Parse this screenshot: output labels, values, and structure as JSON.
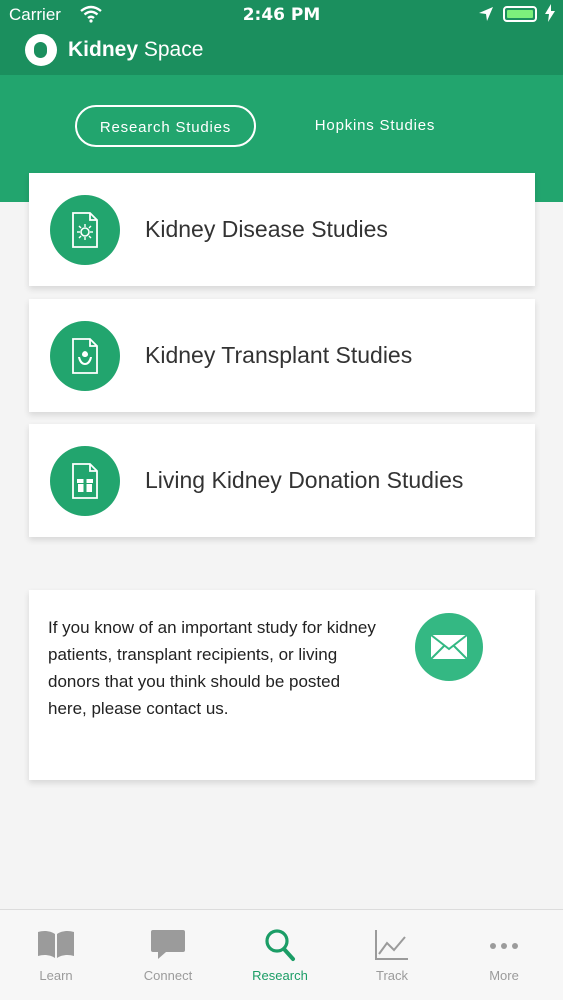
{
  "status_bar": {
    "carrier": "Carrier",
    "time": "2:46 PM"
  },
  "header": {
    "brand_bold": "Kidney",
    "brand_light": "Space"
  },
  "tabs": [
    {
      "label": "Research Studies",
      "active": true
    },
    {
      "label": "Hopkins Studies",
      "active": false
    }
  ],
  "studies": [
    {
      "label": "Kidney Disease Studies",
      "icon": "document-virus-icon"
    },
    {
      "label": "Kidney Transplant Studies",
      "icon": "document-hands-icon"
    },
    {
      "label": "Living Kidney Donation Studies",
      "icon": "document-gift-icon"
    }
  ],
  "contact": {
    "text": "If you know of an important study for kidney patients, transplant recipients, or living donors that you think should be posted here, please contact us.",
    "icon": "mail-icon"
  },
  "tabbar": [
    {
      "label": "Learn",
      "icon": "book-icon",
      "active": false
    },
    {
      "label": "Connect",
      "icon": "chat-bubble-icon",
      "active": false
    },
    {
      "label": "Research",
      "icon": "search-icon",
      "active": true
    },
    {
      "label": "Track",
      "icon": "line-chart-icon",
      "active": false
    },
    {
      "label": "More",
      "icon": "more-dots-icon",
      "active": false
    }
  ],
  "colors": {
    "header_green": "#1b8f5e",
    "band_green": "#22a56e",
    "accent_green": "#1b9d66",
    "mail_green": "#34b883",
    "inactive_gray": "#9b9b9b"
  }
}
